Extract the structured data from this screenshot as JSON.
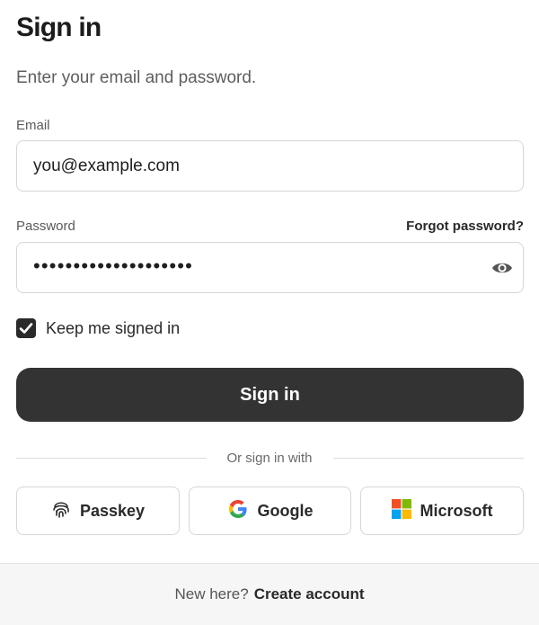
{
  "header": {
    "title": "Sign in",
    "subtitle": "Enter your email and password."
  },
  "email": {
    "label": "Email",
    "value": "you@example.com"
  },
  "password": {
    "label": "Password",
    "masked_value": "••••••••••••••••••••",
    "forgot_label": "Forgot password?",
    "visibility_icon": "eye-icon"
  },
  "keep_signed_in": {
    "label": "Keep me signed in",
    "checked": true
  },
  "primary_button": {
    "label": "Sign in"
  },
  "divider": {
    "label": "Or sign in with"
  },
  "social": [
    {
      "label": "Passkey",
      "icon": "fingerprint-icon"
    },
    {
      "label": "Google",
      "icon": "google-icon"
    },
    {
      "label": "Microsoft",
      "icon": "microsoft-icon"
    }
  ],
  "footer": {
    "question": "New here?",
    "link": "Create account"
  },
  "colors": {
    "primary_button": "#333333",
    "footer_bg": "#f6f6f6",
    "border": "#d6d6d6"
  }
}
